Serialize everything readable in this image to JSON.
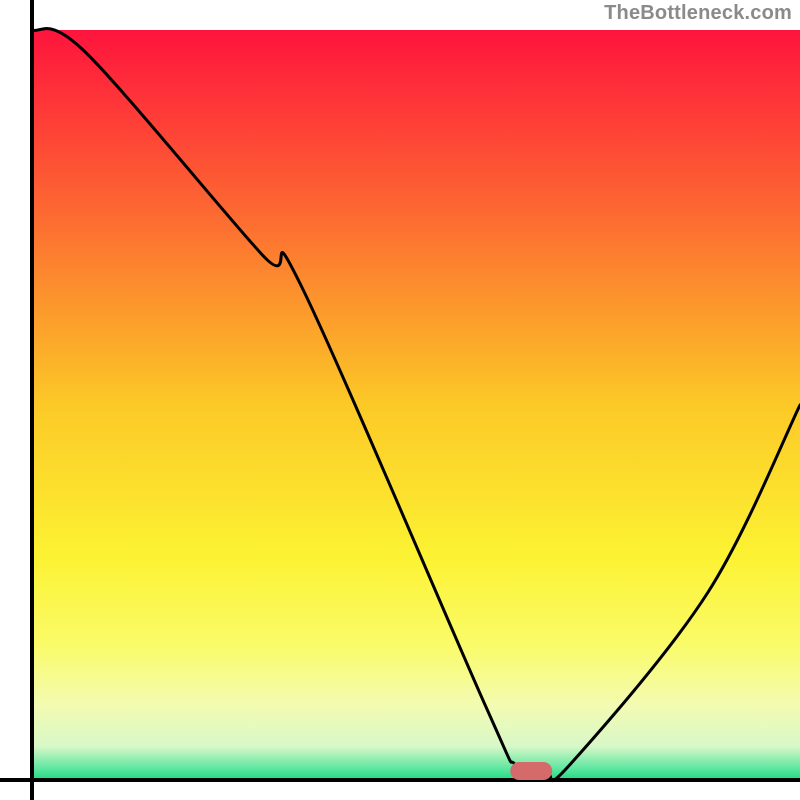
{
  "attribution": "TheBottleneck.com",
  "chart_data": {
    "type": "line",
    "title": "",
    "xlabel": "",
    "ylabel": "",
    "xlim": [
      0,
      100
    ],
    "ylim": [
      0,
      100
    ],
    "x": [
      0,
      7,
      30,
      35,
      59,
      63,
      67,
      70,
      88,
      100
    ],
    "values": [
      100,
      97,
      70,
      66,
      10,
      2,
      1,
      2,
      25,
      50
    ],
    "flat_segment_x": [
      63,
      67
    ],
    "marker": {
      "x": 65,
      "y": 1.2,
      "color": "#d46a6a"
    },
    "gradient_stops": [
      {
        "offset": 0.0,
        "color": "#fe143d"
      },
      {
        "offset": 0.25,
        "color": "#fd6b31"
      },
      {
        "offset": 0.5,
        "color": "#fcc927"
      },
      {
        "offset": 0.7,
        "color": "#fcf232"
      },
      {
        "offset": 0.82,
        "color": "#fafb69"
      },
      {
        "offset": 0.9,
        "color": "#f3fbb1"
      },
      {
        "offset": 0.955,
        "color": "#d8f8c8"
      },
      {
        "offset": 0.985,
        "color": "#5ce6a0"
      },
      {
        "offset": 1.0,
        "color": "#1edb82"
      }
    ],
    "axes_visible": true
  }
}
